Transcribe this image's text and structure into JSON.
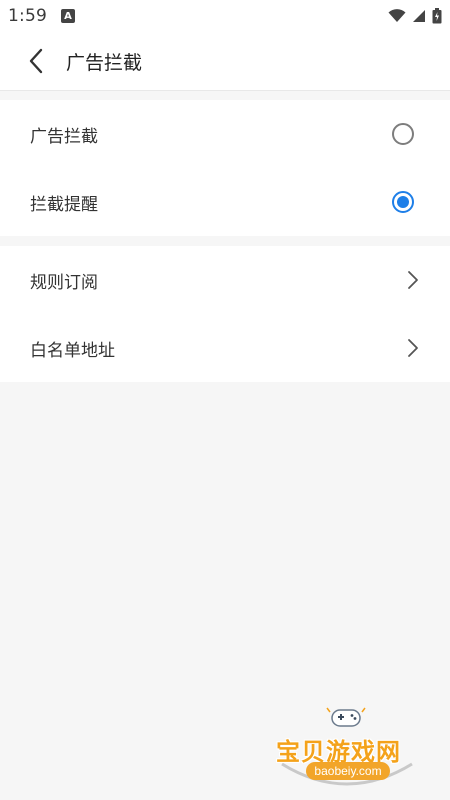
{
  "status_bar": {
    "time": "1:59",
    "notification_icon": "A"
  },
  "header": {
    "title": "广告拦截"
  },
  "settings": {
    "group1": [
      {
        "label": "广告拦截",
        "control": "radio",
        "checked": false
      },
      {
        "label": "拦截提醒",
        "control": "radio",
        "checked": true
      }
    ],
    "group2": [
      {
        "label": "规则订阅",
        "control": "chevron"
      },
      {
        "label": "白名单地址",
        "control": "chevron"
      }
    ]
  },
  "watermark": {
    "title": "宝贝游戏网",
    "url": "baobeiy.com"
  },
  "colors": {
    "accent": "#1e7fe8",
    "background": "#f6f6f6",
    "watermark": "#f4a21a"
  }
}
